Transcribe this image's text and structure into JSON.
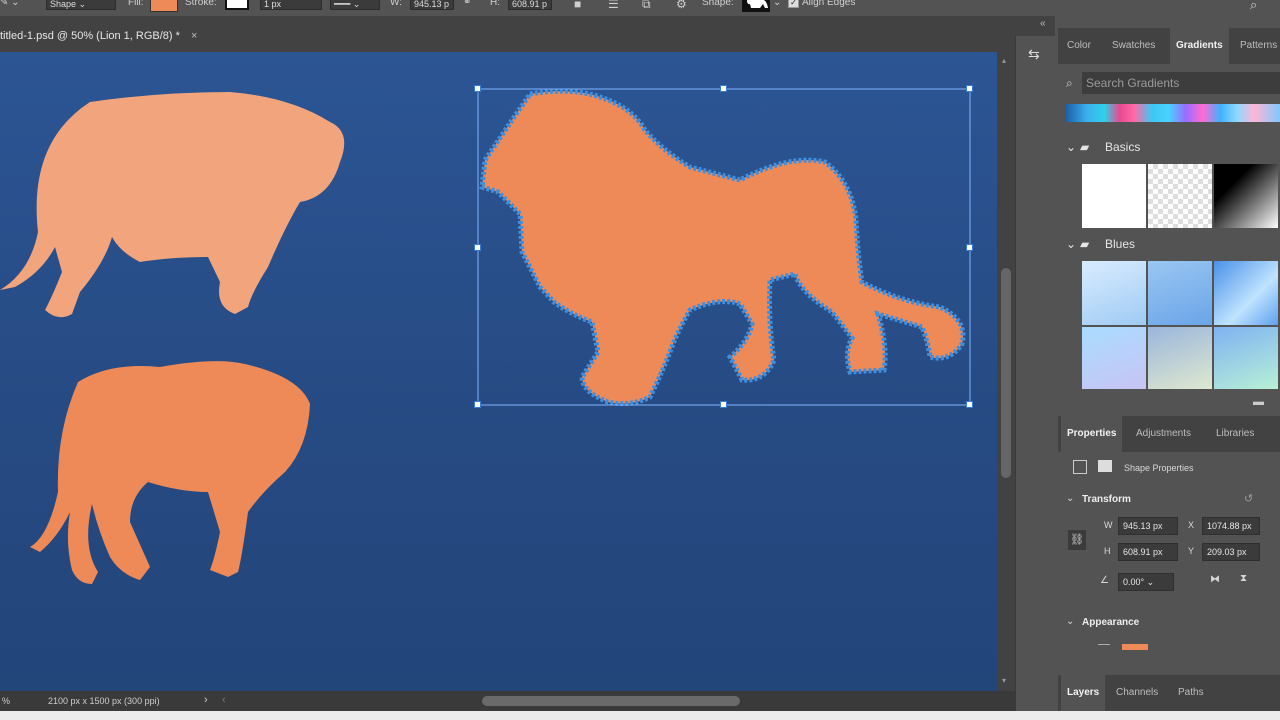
{
  "optbar": {
    "mode": "Shape",
    "fill_label": "Fill:",
    "stroke_label": "Stroke:",
    "stroke_width": "1 px",
    "w_label": "W:",
    "w_value": "945.13 p",
    "h_label": "H:",
    "h_value": "608.91 p",
    "shape_label": "Shape:",
    "align_edges": "Align Edges",
    "fill_color": "#ee8a58"
  },
  "doc_tab": {
    "title": "titled-1.psd @ 50% (Lion 1, RGB/8) *",
    "close": "×"
  },
  "status": {
    "zoom": "%",
    "size": "2100 px x 1500 px (300 ppi)",
    "arrow": "›"
  },
  "panel_top": {
    "tabs": [
      "Color",
      "Swatches",
      "Gradients",
      "Patterns"
    ],
    "active_tab": "Gradients",
    "search_placeholder": "Search Gradients",
    "groups": [
      {
        "name": "Basics"
      },
      {
        "name": "Blues"
      }
    ]
  },
  "properties": {
    "tabs": [
      "Properties",
      "Adjustments",
      "Libraries"
    ],
    "shape_properties": "Shape Properties",
    "transform": {
      "title": "Transform",
      "w_label": "W",
      "w": "945.13 px",
      "x_label": "X",
      "x": "1074.88 px",
      "h_label": "H",
      "h": "608.91 px",
      "y_label": "Y",
      "y": "209.03 px",
      "angle": "0.00°"
    },
    "appearance": {
      "title": "Appearance",
      "fill_color": "#ee8a58"
    }
  },
  "layers_tabs": [
    "Layers",
    "Channels",
    "Paths"
  ],
  "colors": {
    "canvas_top": "#2c5594",
    "tiger_light": "#f2a57d",
    "tiger_dark": "#ee8a58",
    "lion": "#ee8a58",
    "lion_outline": "#3d8fe0"
  }
}
